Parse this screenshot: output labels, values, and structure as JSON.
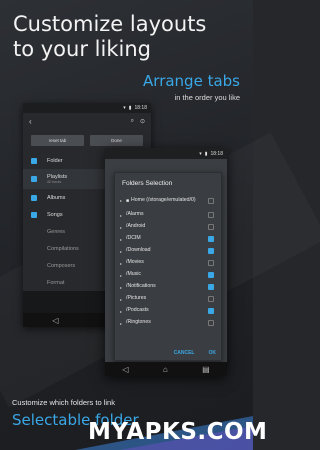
{
  "headline": {
    "line1": "Customize layouts",
    "line2": "to your liking"
  },
  "tagline1": {
    "title": "Arrange tabs",
    "subtitle": "in the order you like"
  },
  "tagline2": {
    "subtitle": "Customize which folders to link",
    "title": "Selectable folder"
  },
  "watermark": {
    "text": "MYAPKS.COM"
  },
  "status_time": "18:18",
  "phone1": {
    "buttons": [
      "reset tab",
      "Done"
    ],
    "rows": [
      {
        "label": "Folder",
        "sub": "",
        "checked": true
      },
      {
        "label": "Playlists",
        "sub": "All tracks",
        "checked": true
      },
      {
        "label": "Albums",
        "sub": "",
        "checked": true
      },
      {
        "label": "Songs",
        "sub": "",
        "checked": true
      },
      {
        "label": "Genres",
        "sub": "",
        "checked": false
      },
      {
        "label": "Compilations",
        "sub": "",
        "checked": false
      },
      {
        "label": "Composers",
        "sub": "",
        "checked": false
      },
      {
        "label": "Format",
        "sub": "",
        "checked": false
      }
    ]
  },
  "dialog": {
    "title": "Folders Selection",
    "home": "Home (/storage/emulated/0)",
    "folders": [
      {
        "label": "/Alarms",
        "checked": false
      },
      {
        "label": "/Android",
        "checked": false
      },
      {
        "label": "/DCIM",
        "checked": true
      },
      {
        "label": "/Download",
        "checked": true
      },
      {
        "label": "/Movies",
        "checked": false
      },
      {
        "label": "/Music",
        "checked": true
      },
      {
        "label": "/Notifications",
        "checked": true
      },
      {
        "label": "/Pictures",
        "checked": false
      },
      {
        "label": "/Podcasts",
        "checked": true
      },
      {
        "label": "/Ringtones",
        "checked": false
      }
    ],
    "cancel": "CANCEL",
    "ok": "OK"
  },
  "colors": {
    "accent": "#3aa7e6",
    "background": "#25272b"
  },
  "icons": [
    "back-arrow-icon",
    "search-icon",
    "more-icon",
    "nav-back-icon",
    "nav-home-icon",
    "nav-recents-icon",
    "folder-icon",
    "wifi-icon",
    "battery-icon"
  ]
}
